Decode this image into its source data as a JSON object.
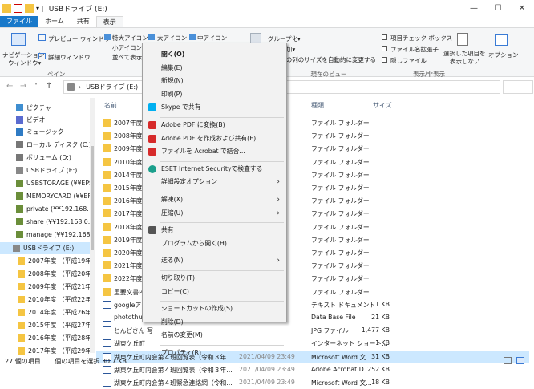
{
  "window": {
    "title": "USBドライブ (E:)",
    "minimize": "—",
    "maximize": "☐",
    "close": "✕"
  },
  "ribbon_tabs": [
    "ファイル",
    "ホーム",
    "共有",
    "表示"
  ],
  "ribbon": {
    "nav_pane": "ナビゲーション\nウィンドウ",
    "nav_pane_1": "ナビゲーション",
    "nav_pane_2": "ウィンドウ▾",
    "preview": "プレビュー ウィンドウ",
    "details": "詳細ウィンドウ",
    "pane_group": "ペイン",
    "xl_icons": "特大アイコン",
    "large_icons": "大アイコン",
    "medium_icons": "中アイコン",
    "small_icons": "小アイコン",
    "list": "並べて表示",
    "group_by": "グループ化▾",
    "add_col": "の追加▾",
    "fit_cols": "べての列のサイズを自動的に変更する",
    "current_view": "現在のビュー",
    "item_check": "項目チェック ボックス",
    "ext": "ファイル名拡張子",
    "hidden": "隠しファイル",
    "hide_selected_1": "選択した項目を",
    "hide_selected_2": "表示しない",
    "show_hide": "表示/非表示",
    "options": "オプション"
  },
  "address": {
    "path": "USBドライブ (E:)"
  },
  "nav_items": [
    "ピクチャ",
    "ビデオ",
    "ミュージック",
    "ローカル ディスク (C:)",
    "ボリューム (D:)",
    "USBドライブ (E:)",
    "USBSTORAGE (¥¥EPS",
    "MEMORYCARD (¥¥EF",
    "private (¥¥192.168.",
    "share (¥¥192.168.0.1",
    "manage (¥¥192.168.",
    "USBドライブ (E:)",
    "2007年度 （平成19年",
    "2008年度 （平成20年",
    "2009年度 （平成21年",
    "2010年度 （平成22年",
    "2014年度 （平成26年",
    "2015年度 （平成27年",
    "2016年度 （平成28年",
    "2017年度 （平成29年"
  ],
  "columns": {
    "name": "名前",
    "type": "種類",
    "size": "サイズ"
  },
  "files": [
    {
      "name": "2007年度",
      "date": "",
      "type": "ファイル フォルダー",
      "size": ""
    },
    {
      "name": "2008年度",
      "date": "",
      "type": "ファイル フォルダー",
      "size": ""
    },
    {
      "name": "2009年度",
      "date": "",
      "type": "ファイル フォルダー",
      "size": ""
    },
    {
      "name": "2010年度",
      "date": "",
      "type": "ファイル フォルダー",
      "size": ""
    },
    {
      "name": "2014年度",
      "date": "",
      "type": "ファイル フォルダー",
      "size": ""
    },
    {
      "name": "2015年度",
      "date": "",
      "type": "ファイル フォルダー",
      "size": ""
    },
    {
      "name": "2016年度",
      "date": "",
      "type": "ファイル フォルダー",
      "size": ""
    },
    {
      "name": "2017年度",
      "date": "",
      "type": "ファイル フォルダー",
      "size": ""
    },
    {
      "name": "2018年度",
      "date": "",
      "type": "ファイル フォルダー",
      "size": ""
    },
    {
      "name": "2019年度",
      "date": "",
      "type": "ファイル フォルダー",
      "size": ""
    },
    {
      "name": "2020年度",
      "date": "",
      "type": "ファイル フォルダー",
      "size": ""
    },
    {
      "name": "2021年度",
      "date": "",
      "type": "ファイル フォルダー",
      "size": ""
    },
    {
      "name": "2022年度",
      "date": "",
      "type": "ファイル フォルダー",
      "size": ""
    },
    {
      "name": "重要文書P",
      "date": "",
      "type": "ファイル フォルダー",
      "size": ""
    },
    {
      "name": "googleアカ",
      "date": "",
      "type": "テキスト ドキュメント",
      "size": "1 KB"
    },
    {
      "name": "photothum",
      "date": "",
      "type": "Data Base File",
      "size": "21 KB"
    },
    {
      "name": "とんどさん 写",
      "date": "",
      "type": "JPG ファイル",
      "size": "1,477 KB"
    },
    {
      "name": "湖東ケ丘町",
      "date": "",
      "type": "インターネット ショート...",
      "size": "1 KB"
    },
    {
      "name": "湖東ケ丘町内会第４班回覧表（令和３年...",
      "date": "2021/04/09 23:49",
      "type": "Microsoft Word 文...",
      "size": "31 KB"
    },
    {
      "name": "湖東ケ丘町内会第４班回覧表（令和３年...",
      "date": "2021/04/09 23:49",
      "type": "Adobe Acrobat D...",
      "size": "252 KB"
    },
    {
      "name": "湖東ケ丘町内会第４班緊急連絡網（令和...",
      "date": "2021/04/09 23:49",
      "type": "Microsoft Word 文...",
      "size": "18 KB"
    }
  ],
  "context_menu": [
    {
      "label": "開く(O)",
      "bold": true
    },
    {
      "label": "編集(E)"
    },
    {
      "label": "新規(N)"
    },
    {
      "label": "印刷(P)"
    },
    {
      "label": "Skype で共有",
      "icon": "skype-icon"
    },
    {
      "sep": true
    },
    {
      "label": "Adobe PDF に変換(B)",
      "icon": "pdf-icon"
    },
    {
      "label": "Adobe PDF を作成および共有(E)",
      "icon": "pdf-icon"
    },
    {
      "label": "ファイルを Acrobat で結合...",
      "icon": "pdf-icon"
    },
    {
      "sep": true
    },
    {
      "label": "ESET Internet Securityで検査する",
      "icon": "eset-icon"
    },
    {
      "label": "詳細設定オプション",
      "arrow": true
    },
    {
      "sep": true
    },
    {
      "label": "解凍(X)",
      "arrow": true
    },
    {
      "label": "圧縮(U)",
      "arrow": true
    },
    {
      "sep": true
    },
    {
      "label": "共有",
      "icon": "share-icon"
    },
    {
      "label": "プログラムから開く(H)..."
    },
    {
      "sep": true
    },
    {
      "label": "送る(N)",
      "arrow": true
    },
    {
      "sep": true
    },
    {
      "label": "切り取り(T)"
    },
    {
      "label": "コピー(C)"
    },
    {
      "sep": true
    },
    {
      "label": "ショートカットの作成(S)"
    },
    {
      "label": "削除(D)"
    },
    {
      "label": "名前の変更(M)"
    },
    {
      "sep": true
    },
    {
      "label": "プロパティ(R)"
    }
  ],
  "status": {
    "count": "27 個の項目",
    "selected": "1 個の項目を選択 30.7 KB"
  },
  "colors": {
    "accent": "#1979ca",
    "selection": "#cce8ff",
    "folder": "#f5c542"
  }
}
